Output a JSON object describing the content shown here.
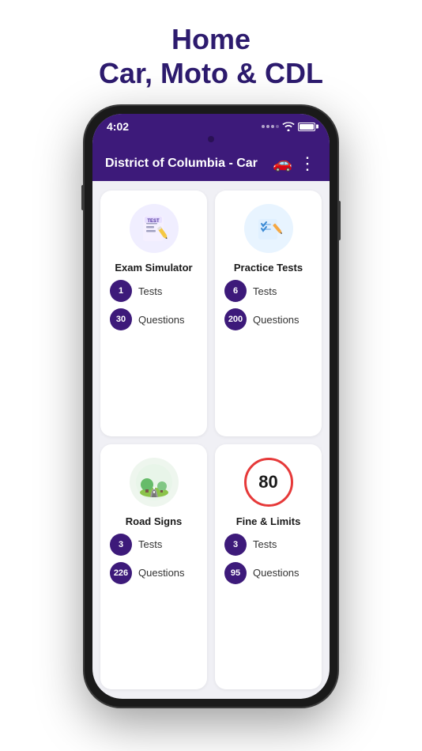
{
  "header": {
    "title": "Home",
    "subtitle": "Car, Moto & CDL"
  },
  "status_bar": {
    "time": "4:02",
    "wifi": "wifi",
    "battery": "battery"
  },
  "app_bar": {
    "title": "District of Columbia - Car",
    "car_icon": "🚗",
    "more_icon": "⋮"
  },
  "cards": [
    {
      "id": "exam-simulator",
      "label": "Exam Simulator",
      "stats": [
        {
          "badge": "1",
          "label": "Tests"
        },
        {
          "badge": "30",
          "label": "Questions"
        }
      ]
    },
    {
      "id": "practice-tests",
      "label": "Practice Tests",
      "stats": [
        {
          "badge": "6",
          "label": "Tests"
        },
        {
          "badge": "200",
          "label": "Questions"
        }
      ]
    },
    {
      "id": "road-signs",
      "label": "Road Signs",
      "stats": [
        {
          "badge": "3",
          "label": "Tests"
        },
        {
          "badge": "226",
          "label": "Questions"
        }
      ]
    },
    {
      "id": "fine-limits",
      "label": "Fine & Limits",
      "speed_limit": "80",
      "stats": [
        {
          "badge": "3",
          "label": "Tests"
        },
        {
          "badge": "95",
          "label": "Questions"
        }
      ]
    }
  ]
}
